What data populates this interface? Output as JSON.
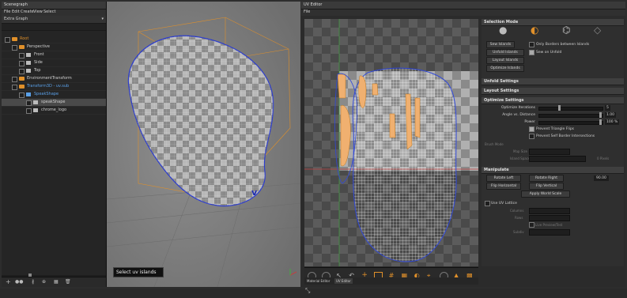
{
  "scenegraph": {
    "title": "Scenegraph",
    "menu": [
      "File",
      "Edit",
      "Create",
      "View",
      "Select"
    ],
    "graph_select": "Extra Graph",
    "nodes": [
      {
        "label": "Root",
        "depth": 0,
        "color": "#e0902a"
      },
      {
        "label": "Perspective",
        "depth": 1,
        "color": "#cfcfcf"
      },
      {
        "label": "Front",
        "depth": 2,
        "color": "#cfcfcf"
      },
      {
        "label": "Side",
        "depth": 2,
        "color": "#cfcfcf"
      },
      {
        "label": "Top",
        "depth": 2,
        "color": "#cfcfcf"
      },
      {
        "label": "EnvironmentTransform",
        "depth": 1,
        "color": "#cfcfcf"
      },
      {
        "label": "Transform3D - uv.sub",
        "depth": 1,
        "color": "#5aa0e8"
      },
      {
        "label": "SpeakShape",
        "depth": 2,
        "color": "#5aa0e8"
      },
      {
        "label": "speakShape",
        "depth": 3,
        "color": "#cfcfcf"
      },
      {
        "label": "chrome_logo",
        "depth": 3,
        "color": "#cfcfcf"
      }
    ]
  },
  "viewport": {
    "tooltip": "Select uv islands"
  },
  "uv_editor": {
    "title": "UV Editor",
    "menu": [
      "File"
    ],
    "tabs": [
      "Material Editor",
      "UV Editor"
    ],
    "selection_mode": {
      "header": "Selection Mode",
      "sew_islands": "Sew Islands",
      "only_borders": "Only Borders between Islands",
      "unfold_islands": "Unfold Islands",
      "sew_on_unfold": "Sew on Unfold",
      "layout_islands": "Layout Islands",
      "optimize_islands": "Optimize Islands"
    },
    "unfold_settings": "Unfold Settings",
    "layout_settings": "Layout Settings",
    "optimize_settings": {
      "header": "Optimize Settings",
      "iterations_label": "Optimize Iterations",
      "iterations_value": "5",
      "angle_label": "Angle vs. Distance",
      "angle_value": "1.00",
      "power_label": "Power",
      "power_value": "100 %",
      "prevent_flips": "Prevent Triangle Flips",
      "prevent_self": "Prevent Self Border Intersections",
      "brush_mode": "Brush Mode",
      "map_size": "Map Size",
      "island_space": "Island Space",
      "pixels": "0 Pixels"
    },
    "manipulate": {
      "header": "Manipulate",
      "rotate_left": "Rotate Left",
      "rotate_right": "Rotate Right",
      "rotate_value": "90.00",
      "flip_h": "Flip Horizontal",
      "flip_v": "Flip Vertical",
      "world_scale": "Apply World Scale",
      "use_lattice": "Use UV Lattice",
      "columns": "Columns",
      "rows": "Rows",
      "live_preview": "Live Preview/Test",
      "subdiv": "Subdiv"
    }
  },
  "colors": {
    "accent": "#e0902a",
    "selection": "#5aa0e8",
    "highlight": "#f0b070"
  }
}
